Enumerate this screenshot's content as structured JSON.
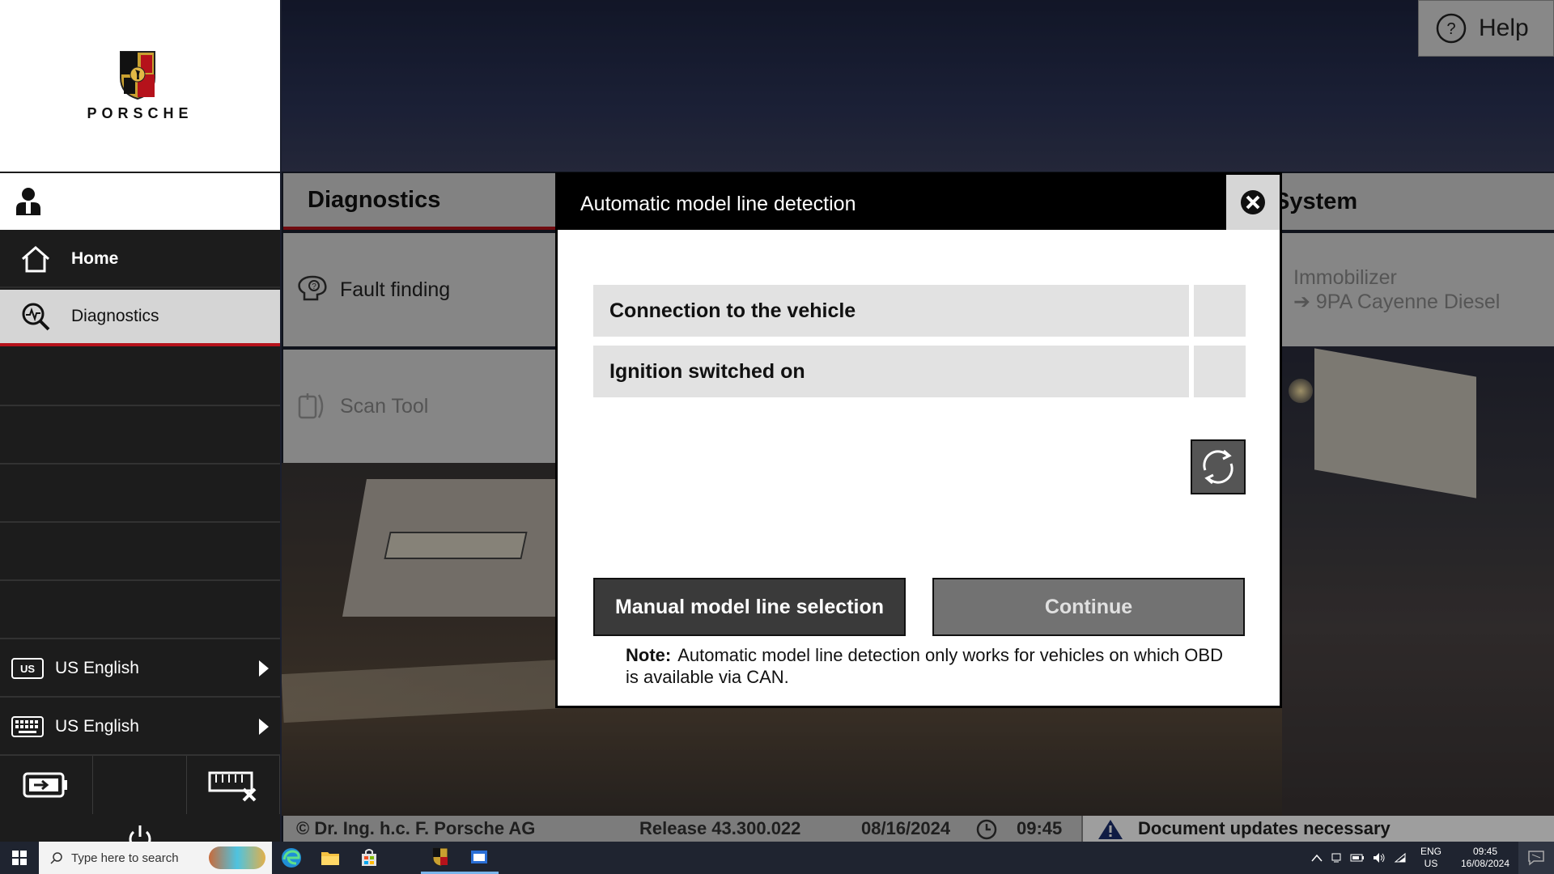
{
  "brand": {
    "wordmark": "PORSCHE"
  },
  "help": {
    "label": "Help"
  },
  "sidebar": {
    "home_label": "Home",
    "diagnostics_label": "Diagnostics",
    "language_label": "US English",
    "language_badge": "US",
    "keyboard_label": "US English"
  },
  "diagnostics": {
    "header": "Diagnostics",
    "fault_finding": "Fault finding",
    "scan_tool": "Scan Tool"
  },
  "system": {
    "header": "System",
    "immobilizer_line1": "Immobilizer",
    "immobilizer_line2": "➔ 9PA Cayenne Diesel"
  },
  "statusbar": {
    "copyright": "© Dr. Ing. h.c. F. Porsche AG",
    "release": "Release 43.300.022",
    "date": "08/16/2024",
    "time": "09:45",
    "documents": "Document updates necessary"
  },
  "modal": {
    "title": "Automatic model line detection",
    "checks": [
      {
        "label": "Connection to the vehicle"
      },
      {
        "label": "Ignition switched on"
      }
    ],
    "manual_button": "Manual model line selection",
    "continue_button": "Continue",
    "note_label": "Note:",
    "note_text": "Automatic model line detection only works for vehicles on which OBD is available via CAN."
  },
  "taskbar": {
    "search_placeholder": "Type here to search",
    "lang_line1": "ENG",
    "lang_line2": "US",
    "time": "09:45",
    "date": "16/08/2024"
  },
  "colors": {
    "accent_red": "#b5121b",
    "modal_header": "#000000",
    "sidebar_bg": "#1c1c1c"
  }
}
